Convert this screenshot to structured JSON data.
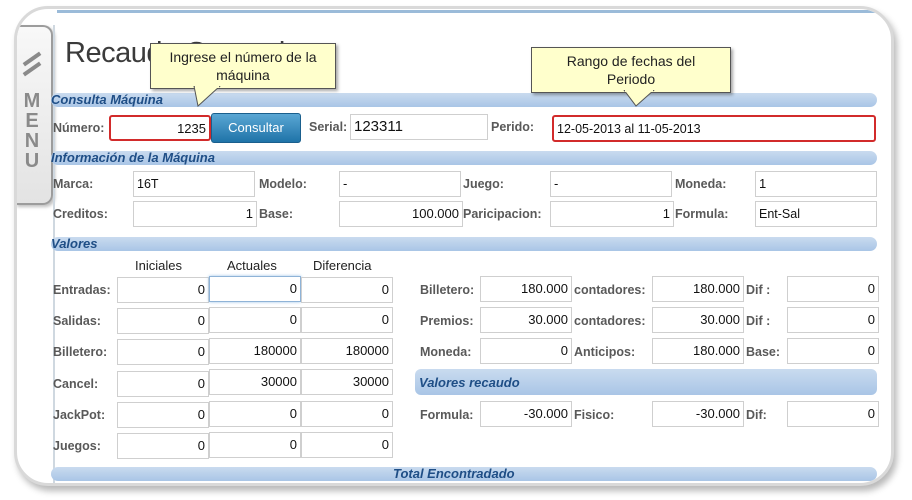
{
  "menu_tab": {
    "letters": [
      "M",
      "E",
      "N",
      "U"
    ]
  },
  "page_title": "Recaudo General",
  "callouts": {
    "numero": {
      "line1": "Ingrese el número de la",
      "line2": "máquina"
    },
    "fechas": {
      "line1": "Rango de fechas del",
      "line2": "Periodo"
    }
  },
  "consulta": {
    "title": "Consulta Máquina",
    "numero_label": "Número:",
    "numero_value": "1235",
    "consultar_label": "Consultar",
    "serial_label": "Serial:",
    "serial_value": "123311",
    "periodo_label": "Perido:",
    "periodo_value": "12-05-2013 al 11-05-2013"
  },
  "informacion": {
    "title": "Información de la Máquina",
    "marca_label": "Marca:",
    "marca_value": "16T",
    "modelo_label": "Modelo:",
    "modelo_value": "-",
    "juego_label": "Juego:",
    "juego_value": "-",
    "moneda_label": "Moneda:",
    "moneda_value": "1",
    "creditos_label": "Creditos:",
    "creditos_value": "1",
    "base_label": "Base:",
    "base_value": "100.000",
    "participacion_label": "Paricipacion:",
    "participacion_value": "1",
    "formula_label": "Formula:",
    "formula_value": "Ent-Sal"
  },
  "valores": {
    "title": "Valores",
    "col_iniciales": "Iniciales",
    "col_actuales": "Actuales",
    "col_diferencia": "Diferencia",
    "rows": [
      {
        "label": "Entradas:",
        "iniciales": "0",
        "actuales": "0",
        "diferencia": "0"
      },
      {
        "label": "Salidas:",
        "iniciales": "0",
        "actuales": "0",
        "diferencia": "0"
      },
      {
        "label": "Billetero:",
        "iniciales": "0",
        "actuales": "180000",
        "diferencia": "180000"
      },
      {
        "label": "Cancel:",
        "iniciales": "0",
        "actuales": "30000",
        "diferencia": "30000"
      },
      {
        "label": "JackPot:",
        "iniciales": "0",
        "actuales": "0",
        "diferencia": "0"
      },
      {
        "label": "Juegos:",
        "iniciales": "0",
        "actuales": "0",
        "diferencia": "0"
      }
    ],
    "right_rows": [
      {
        "label": "Billetero:",
        "value": "180.000",
        "label2": "contadores:",
        "value2": "180.000",
        "label3": "Dif :",
        "value3": "0"
      },
      {
        "label": "Premios:",
        "value": "30.000",
        "label2": "contadores:",
        "value2": "30.000",
        "label3": "Dif :",
        "value3": "0"
      },
      {
        "label": "Moneda:",
        "value": "0",
        "label2": "Anticipos:",
        "value2": "180.000",
        "label3": "Base:",
        "value3": "0"
      }
    ]
  },
  "recaudo": {
    "title": "Valores recaudo",
    "formula_label": "Formula:",
    "formula_value": "-30.000",
    "fisico_label": "Fisico:",
    "fisico_value": "-30.000",
    "dif_label": "Dif:",
    "dif_value": "0"
  },
  "total": {
    "title": "Total Encontradado"
  }
}
